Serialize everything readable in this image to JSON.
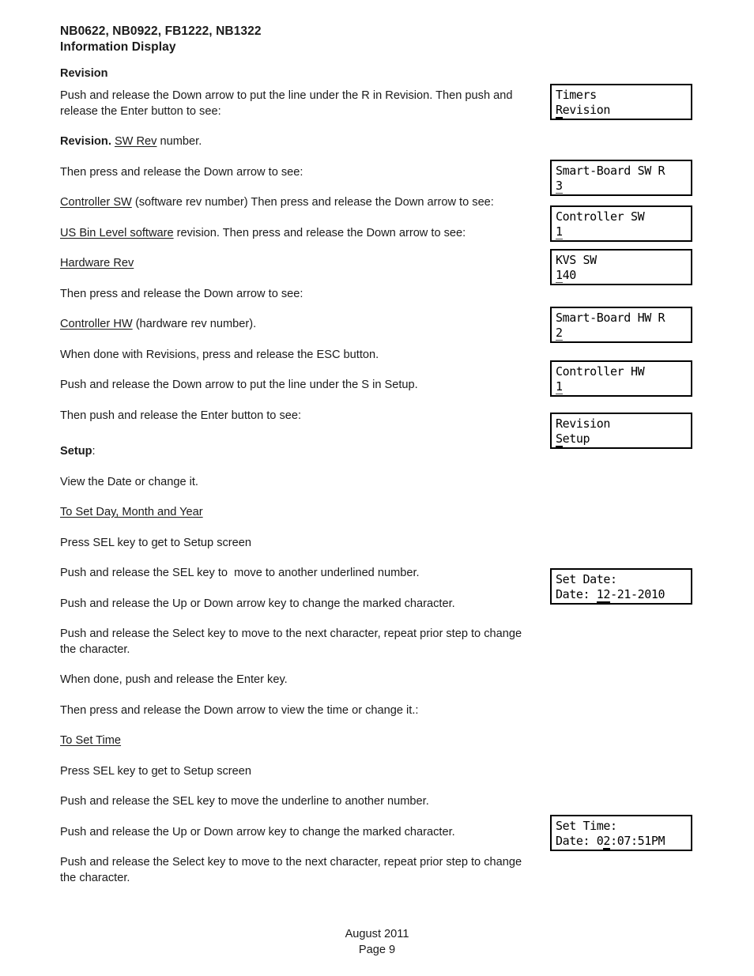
{
  "header": {
    "line1": "NB0622, NB0922, FB1222, NB1322",
    "line2": "Information Display"
  },
  "section": {
    "title": "Revision"
  },
  "body": {
    "p1": "Push and release the Down arrow to put the line under the R in Revision. Then push and release the Enter button to see:",
    "p2_bold": "Revision.",
    "p2_underline": "SW Rev",
    "p2_rest": " number.",
    "p3": "Then press and release the Down arrow to see:",
    "p4_underline": "Controller SW",
    "p4_rest": " (software rev number) Then press and release the Down arrow to see:",
    "p5_underline": "US Bin Level software",
    "p5_rest": " revision. Then press and release the Down arrow to see:",
    "p6_underline": "Hardware Rev",
    "p7": "Then press and release the Down arrow to see:",
    "p8_underline": "Controller HW",
    "p8_rest": " (hardware rev number).",
    "p9": "When done with Revisions, press and release the ESC button.",
    "p10": "Push and release the Down arrow to put the line under the S in Setup.",
    "p11": "Then push and release the Enter button to see:",
    "p12_bold": "Setup",
    "p12_rest": ":",
    "p13": "View the Date or change it.",
    "p14_underline": "To Set Day, Month and Year",
    "p15": "Press SEL key to get to Setup screen",
    "p16": "Push and release the SEL key to  move to another underlined number.",
    "p17": "Push and release the Up or Down arrow key to change the marked character.",
    "p18": "Push and release the Select key to move to the next character, repeat prior step to change the character.",
    "p19": "When done, push and release the Enter key.",
    "p20": "Then press and release the Down arrow to view the time or change it.:",
    "p21_underline": "To Set Time",
    "p22": "Press SEL key to get to Setup screen",
    "p23": "Push and release the SEL key to move the underline to another number.",
    "p24": "Push and release the Up or Down arrow key to change the marked character.",
    "p25": "Push and release the Select key to move to the next character, repeat prior step to change the character."
  },
  "displays": [
    {
      "id": "timers-revision",
      "line1": "Timers",
      "line2_cursor": "R",
      "line2_rest": "evision"
    },
    {
      "id": "smartboard-sw",
      "line1": "Smart-Board SW R",
      "line2_cursor": "3",
      "line2_rest": ""
    },
    {
      "id": "controller-sw",
      "line1": "Controller SW",
      "line2_cursor": "1",
      "line2_rest": ""
    },
    {
      "id": "kvs-sw",
      "line1": "KVS SW",
      "line2_cursor": "1",
      "line2_rest": "40"
    },
    {
      "id": "smartboard-hw",
      "line1": "Smart-Board HW R",
      "line2_cursor": "2",
      "line2_rest": ""
    },
    {
      "id": "controller-hw",
      "line1": "Controller HW",
      "line2_cursor": "1",
      "line2_rest": ""
    },
    {
      "id": "revision-setup",
      "line1": "Revision",
      "line2_cursor": "S",
      "line2_rest": "etup"
    },
    {
      "id": "set-date",
      "line1": "Set Date:",
      "line2_pre": "Date: ",
      "line2_cursor": "12",
      "line2_rest": "-21-2010"
    },
    {
      "id": "set-time",
      "line1": "Set Time:",
      "line2_pre": "Date: 0",
      "line2_cursor": "2",
      "line2_rest": ":07:51PM"
    }
  ],
  "footer": {
    "date": "August 2011",
    "page": "Page 9"
  }
}
